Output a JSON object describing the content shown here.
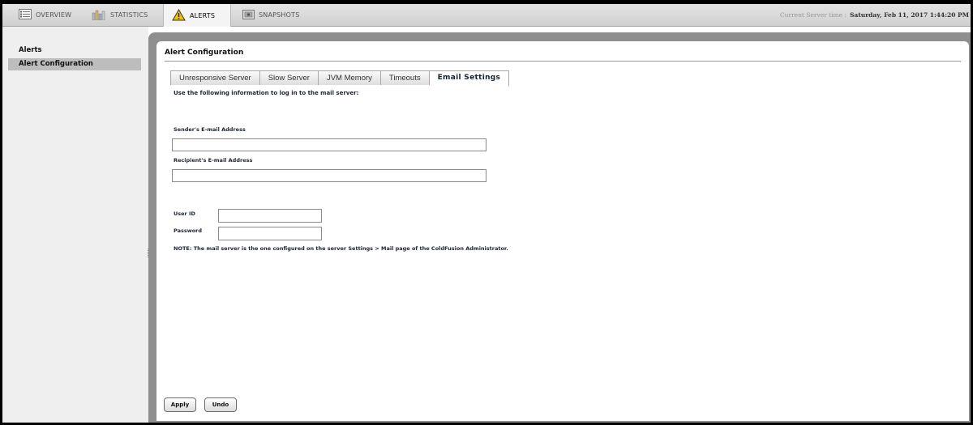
{
  "topnav": {
    "tabs": [
      {
        "label": "OVERVIEW",
        "icon": "checklist-icon"
      },
      {
        "label": "STATISTICS",
        "icon": "bar-chart-icon"
      },
      {
        "label": "ALERTS",
        "icon": "warning-icon",
        "active": true
      },
      {
        "label": "SNAPSHOTS",
        "icon": "camera-icon"
      }
    ],
    "server_time_label": "Current Server time :",
    "server_time_value": "Saturday, Feb 11, 2017  1:44:20 PM"
  },
  "sidebar": {
    "items": [
      {
        "label": "Alerts"
      },
      {
        "label": "Alert Configuration",
        "selected": true
      }
    ]
  },
  "main": {
    "title": "Alert Configuration",
    "tabs": [
      {
        "label": "Unresponsive Server"
      },
      {
        "label": "Slow Server"
      },
      {
        "label": "JVM Memory"
      },
      {
        "label": "Timeouts"
      },
      {
        "label": "Email Settings",
        "active": true
      }
    ],
    "form": {
      "intro": "Use the following information to log in to the mail server:",
      "sender_label": "Sender's E-mail Address",
      "sender_value": "",
      "recipient_label": "Recipient's E-mail Address",
      "recipient_value": "",
      "userid_label": "User ID",
      "userid_value": "",
      "password_label": "Password",
      "password_value": "",
      "note": "NOTE: The mail server is the one configured on the server Settings > Mail page of the ColdFusion Administrator."
    },
    "buttons": {
      "apply": "Apply",
      "undo": "Undo"
    }
  },
  "colors": {
    "frame": "#000000",
    "content_border": "#8f8f8f",
    "sidebar_bg": "#efefef",
    "selected_bg": "#bdbdbd",
    "warning": "#f2c200"
  }
}
